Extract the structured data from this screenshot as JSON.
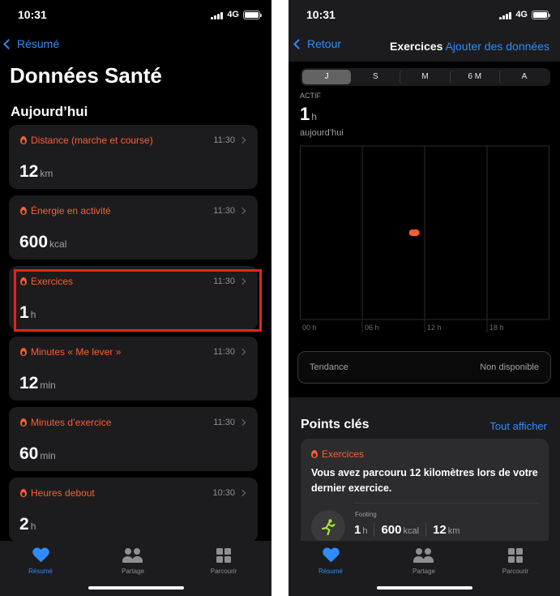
{
  "left": {
    "status": {
      "time": "10:31",
      "network": "4G"
    },
    "back_label": "Résumé",
    "title": "Données Santé",
    "section": "Aujourd’hui",
    "cards": [
      {
        "label": "Distance (marche et course)",
        "time": "11:30",
        "value": "12",
        "unit": "km"
      },
      {
        "label": "Énergie en activité",
        "time": "11:30",
        "value": "600",
        "unit": "kcal"
      },
      {
        "label": "Exercices",
        "time": "11:30",
        "value": "1",
        "unit": "h"
      },
      {
        "label": "Minutes « Me lever »",
        "time": "11:30",
        "value": "12",
        "unit": "min"
      },
      {
        "label": "Minutes d’exercice",
        "time": "11:30",
        "value": "60",
        "unit": "min"
      },
      {
        "label": "Heures debout",
        "time": "10:30",
        "value": "2",
        "unit": "h"
      }
    ],
    "tabs": [
      {
        "label": "Résumé",
        "icon": "heart-icon"
      },
      {
        "label": "Partage",
        "icon": "people-icon"
      },
      {
        "label": "Parcourir",
        "icon": "grid-icon"
      }
    ]
  },
  "right": {
    "status": {
      "time": "10:31",
      "network": "4G"
    },
    "back_label": "Retour",
    "nav_title": "Exercices",
    "nav_action": "Ajouter des données",
    "segments": [
      "J",
      "S",
      "M",
      "6 M",
      "A"
    ],
    "selected_segment": "J",
    "metric_label": "ACTIF",
    "metric_value": "1",
    "metric_unit": "h",
    "metric_period": "aujourd’hui",
    "chart_data": {
      "type": "bar",
      "x_ticks": [
        "00 h",
        "06 h",
        "12 h",
        "18 h"
      ],
      "xlim": [
        0,
        24
      ],
      "grid": true,
      "bars": [
        {
          "start_hour": 10.5,
          "end_hour": 11.5,
          "value": 1
        }
      ],
      "color": "#ff5d31"
    },
    "trend": {
      "label": "Tendance",
      "value": "Non disponible"
    },
    "key_points": {
      "title": "Points clés",
      "link": "Tout afficher",
      "card": {
        "label": "Exercices",
        "text": "Vous avez parcouru 12 kilomètres lors de votre dernier exercice.",
        "activity": "Footing",
        "stats": [
          {
            "value": "1",
            "unit": "h"
          },
          {
            "value": "600",
            "unit": "kcal"
          },
          {
            "value": "12",
            "unit": "km"
          }
        ]
      }
    },
    "tabs": [
      {
        "label": "Résumé",
        "icon": "heart-icon"
      },
      {
        "label": "Partage",
        "icon": "people-icon"
      },
      {
        "label": "Parcourir",
        "icon": "grid-icon"
      }
    ]
  },
  "colors": {
    "accent": "#2f8cff",
    "activity": "#ff5d31",
    "highlight": "#e0261b"
  }
}
